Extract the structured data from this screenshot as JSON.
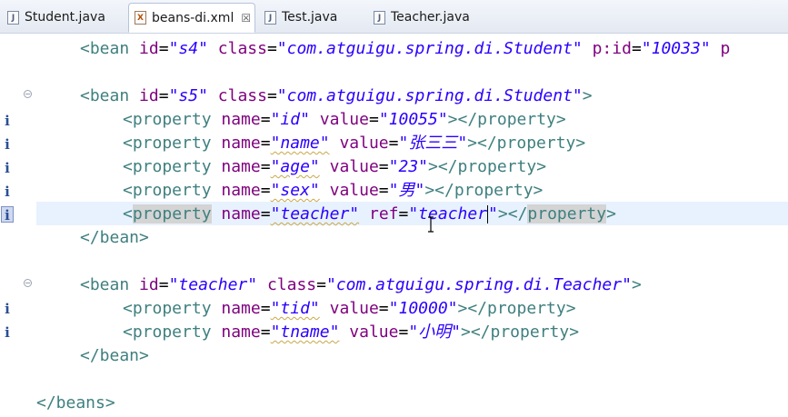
{
  "tabs": [
    {
      "label": "Student.java",
      "icon": "java-file-icon",
      "active": false
    },
    {
      "label": "beans-di.xml",
      "icon": "xml-file-icon",
      "active": true,
      "close": "☒"
    },
    {
      "label": "Test.java",
      "icon": "java-file-icon",
      "active": false
    },
    {
      "label": "Teacher.java",
      "icon": "java-file-icon",
      "active": false
    }
  ],
  "code": {
    "l1": {
      "open": "<bean ",
      "a1": "id",
      "v1": "\"s4\"",
      "a2": "class",
      "v2": "\"com.atguigu.spring.di.Student\"",
      "a3": "p:id",
      "v3": "\"10033\"",
      "tail": " p"
    },
    "l2": {
      "open": "<bean ",
      "a1": "id",
      "v1": "\"s5\"",
      "a2": "class",
      "v2": "\"com.atguigu.spring.di.Student\"",
      "close": ">"
    },
    "l3": {
      "open": "<property ",
      "a1": "name",
      "v1": "\"id\"",
      "a2": "value",
      "v2": "\"10055\"",
      "close": "></property>"
    },
    "l4": {
      "open": "<property ",
      "a1": "name",
      "v1": "\"name\"",
      "a2": "value",
      "v2": "\"张三三\"",
      "close": "></property>"
    },
    "l5": {
      "open": "<property ",
      "a1": "name",
      "v1": "\"age\"",
      "a2": "value",
      "v2": "\"23\"",
      "close": "></property>"
    },
    "l6": {
      "open": "<property ",
      "a1": "name",
      "v1": "\"sex\"",
      "a2": "value",
      "v2": "\"男\"",
      "close": "></property>"
    },
    "l7": {
      "lt": "<",
      "kw": "property",
      "a1": "name",
      "v1": "\"teacher\"",
      "a2": "ref",
      "v2a": "\"teacher",
      "v2b": "\"",
      "close1": "></",
      "kw2": "property",
      "close2": ">"
    },
    "l8": {
      "text": "</bean>"
    },
    "l9": {
      "open": "<bean ",
      "a1": "id",
      "v1": "\"teacher\"",
      "a2": "class",
      "v2": "\"com.atguigu.spring.di.Teacher\"",
      "close": ">"
    },
    "l10": {
      "open": "<property ",
      "a1": "name",
      "v1": "\"tid\"",
      "a2": "value",
      "v2": "\"10000\"",
      "close": "></property>"
    },
    "l11": {
      "open": "<property ",
      "a1": "name",
      "v1": "\"tname\"",
      "a2": "value",
      "v2": "\"小明\"",
      "close": "></property>"
    },
    "l12": {
      "text": "</bean>"
    },
    "l13": {
      "text": "</beans>"
    }
  },
  "gutter": {
    "info_glyph": "i",
    "fold_glyph": "−"
  }
}
